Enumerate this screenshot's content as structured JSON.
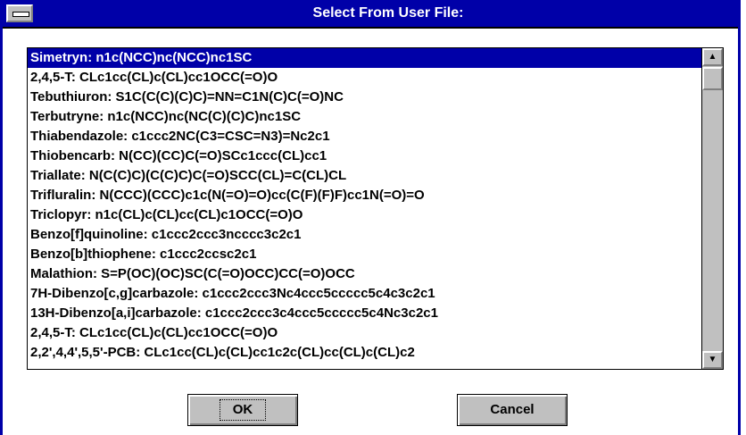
{
  "window": {
    "title": "Select From User File:"
  },
  "list": {
    "items": [
      "Simetryn: n1c(NCC)nc(NCC)nc1SC",
      "2,4,5-T: CLc1cc(CL)c(CL)cc1OCC(=O)O",
      "Tebuthiuron: S1C(C(C)(C)C)=NN=C1N(C)C(=O)NC",
      "Terbutryne: n1c(NCC)nc(NC(C)(C)C)nc1SC",
      "Thiabendazole: c1ccc2NC(C3=CSC=N3)=Nc2c1",
      "Thiobencarb: N(CC)(CC)C(=O)SCc1ccc(CL)cc1",
      "Triallate: N(C(C)C)(C(C)C)C(=O)SCC(CL)=C(CL)CL",
      "Trifluralin: N(CCC)(CCC)c1c(N(=O)=O)cc(C(F)(F)F)cc1N(=O)=O",
      "Triclopyr: n1c(CL)c(CL)cc(CL)c1OCC(=O)O",
      "Benzo[f]quinoline: c1ccc2ccc3ncccc3c2c1",
      "Benzo[b]thiophene: c1ccc2ccsc2c1",
      "Malathion: S=P(OC)(OC)SC(C(=O)OCC)CC(=O)OCC",
      "7H-Dibenzo[c,g]carbazole: c1ccc2ccc3Nc4ccc5ccccc5c4c3c2c1",
      "13H-Dibenzo[a,i]carbazole: c1ccc2ccc3c4ccc5ccccc5c4Nc3c2c1",
      "2,4,5-T: CLc1cc(CL)c(CL)cc1OCC(=O)O",
      "2,2',4,4',5,5'-PCB: CLc1cc(CL)c(CL)cc1c2c(CL)cc(CL)c(CL)c2"
    ],
    "selected_index": 0
  },
  "scrollbar": {
    "up_icon": "▲",
    "down_icon": "▼"
  },
  "buttons": {
    "ok_label": "OK",
    "cancel_label": "Cancel"
  }
}
